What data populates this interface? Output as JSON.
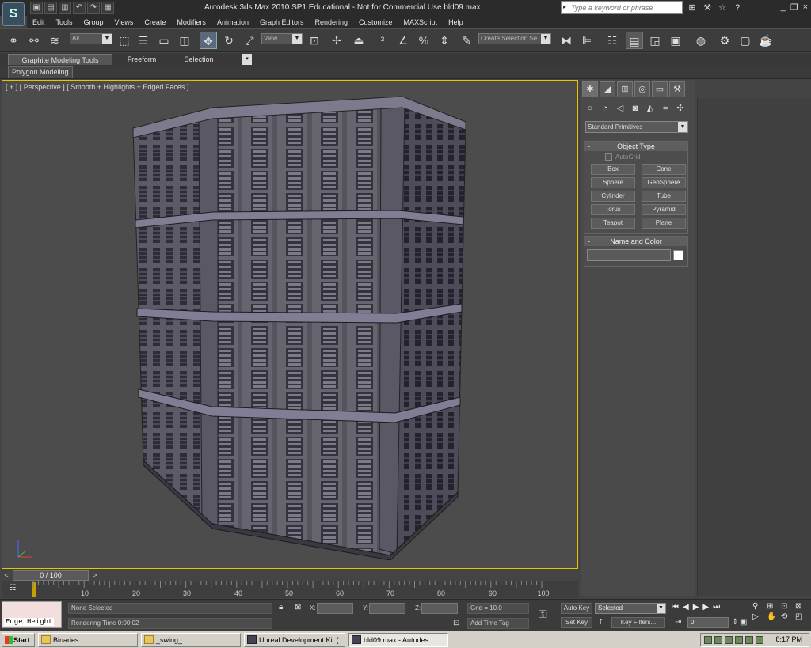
{
  "app": {
    "logo_glyph": "S",
    "title": "Autodesk 3ds Max  2010 SP1   Educational - Not for Commercial Use    bld09.max",
    "search_placeholder": "Type a keyword or phrase",
    "window_buttons": [
      "_",
      "❐",
      "×"
    ]
  },
  "quick_access": [
    "▣",
    "▤",
    "▥",
    "↶",
    "↷",
    "▦"
  ],
  "title_icons": [
    "⊞",
    "⚒",
    "☆",
    "?"
  ],
  "menu": [
    "Edit",
    "Tools",
    "Group",
    "Views",
    "Create",
    "Modifiers",
    "Animation",
    "Graph Editors",
    "Rendering",
    "Customize",
    "MAXScript",
    "Help"
  ],
  "toolbar": {
    "selection_filter": "All",
    "ref_coord": "View",
    "named_selection": "Create Selection Se"
  },
  "ribbon": {
    "tabs": [
      "Graphite Modeling Tools",
      "Freeform",
      "Selection"
    ],
    "panel": "Polygon Modeling"
  },
  "viewport": {
    "label": "[ + ] [ Perspective ] [ Smooth + Highlights + Edged Faces ]"
  },
  "command_panel": {
    "category": "Standard Primitives",
    "object_type_title": "Object Type",
    "autogrid": "AutoGrid",
    "objects": [
      "Box",
      "Cone",
      "Sphere",
      "GeoSphere",
      "Cylinder",
      "Tube",
      "Torus",
      "Pyramid",
      "Teapot",
      "Plane"
    ],
    "name_color_title": "Name and Color"
  },
  "timeslider": {
    "value": "0 / 100",
    "prev": "<",
    "next": ">"
  },
  "trackbar": {
    "ticks": [
      "10",
      "20",
      "30",
      "40",
      "50",
      "60",
      "70",
      "80",
      "90",
      "100"
    ]
  },
  "status": {
    "edge_height": "Edge Height",
    "selection": "None Selected",
    "rendering_time": "Rendering Time  0:00:02",
    "x": "X:",
    "y": "Y:",
    "z": "Z:",
    "grid": "Grid = 10.0",
    "add_time_tag": "Add Time Tag",
    "auto_key": "Auto Key",
    "set_key": "Set Key",
    "key_mode": "Selected",
    "key_filters": "Key Filters...",
    "frame": "0"
  },
  "taskbar": {
    "start": "Start",
    "tasks": [
      "Binaries",
      "_swing_",
      "Unreal Development Kit (...",
      "bld09.max - Autodes..."
    ],
    "clock": "8:17 PM"
  },
  "colors": {
    "viewport_border": "#e8c400",
    "key_marker": "#c8a000"
  }
}
